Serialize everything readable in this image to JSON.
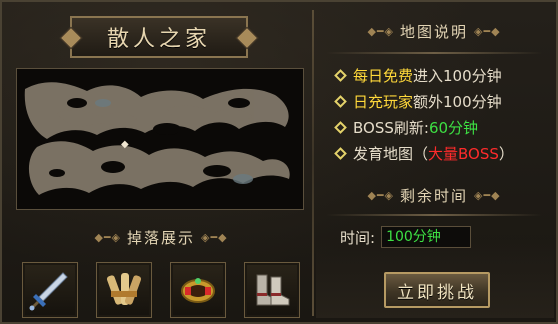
{
  "left_panel": {
    "title": "散人之家",
    "drops_heading": "掉落展示",
    "drop_items": [
      {
        "name": "sword-icon"
      },
      {
        "name": "scroll-bundle-icon"
      },
      {
        "name": "jeweled-bracer-icon"
      },
      {
        "name": "boots-icon"
      }
    ]
  },
  "right_panel": {
    "map_desc_heading": "地图说明",
    "info": [
      {
        "highlight": "每日免费",
        "rest": "进入100分钟"
      },
      {
        "highlight": "日充玩家",
        "rest": "额外100分钟"
      },
      {
        "prefix": "BOSS刷新:",
        "value": "60分钟"
      },
      {
        "prefix": "发育地图（",
        "value": "大量BOSS",
        "suffix": "）"
      }
    ],
    "remaining_heading": "剩余时间",
    "time_label": "时间:",
    "time_value": "100分钟",
    "challenge_button": "立即挑战"
  },
  "colors": {
    "gold": "#ffd83a",
    "green": "#3de043",
    "red": "#ff2b2b",
    "border": "#8a7550"
  }
}
